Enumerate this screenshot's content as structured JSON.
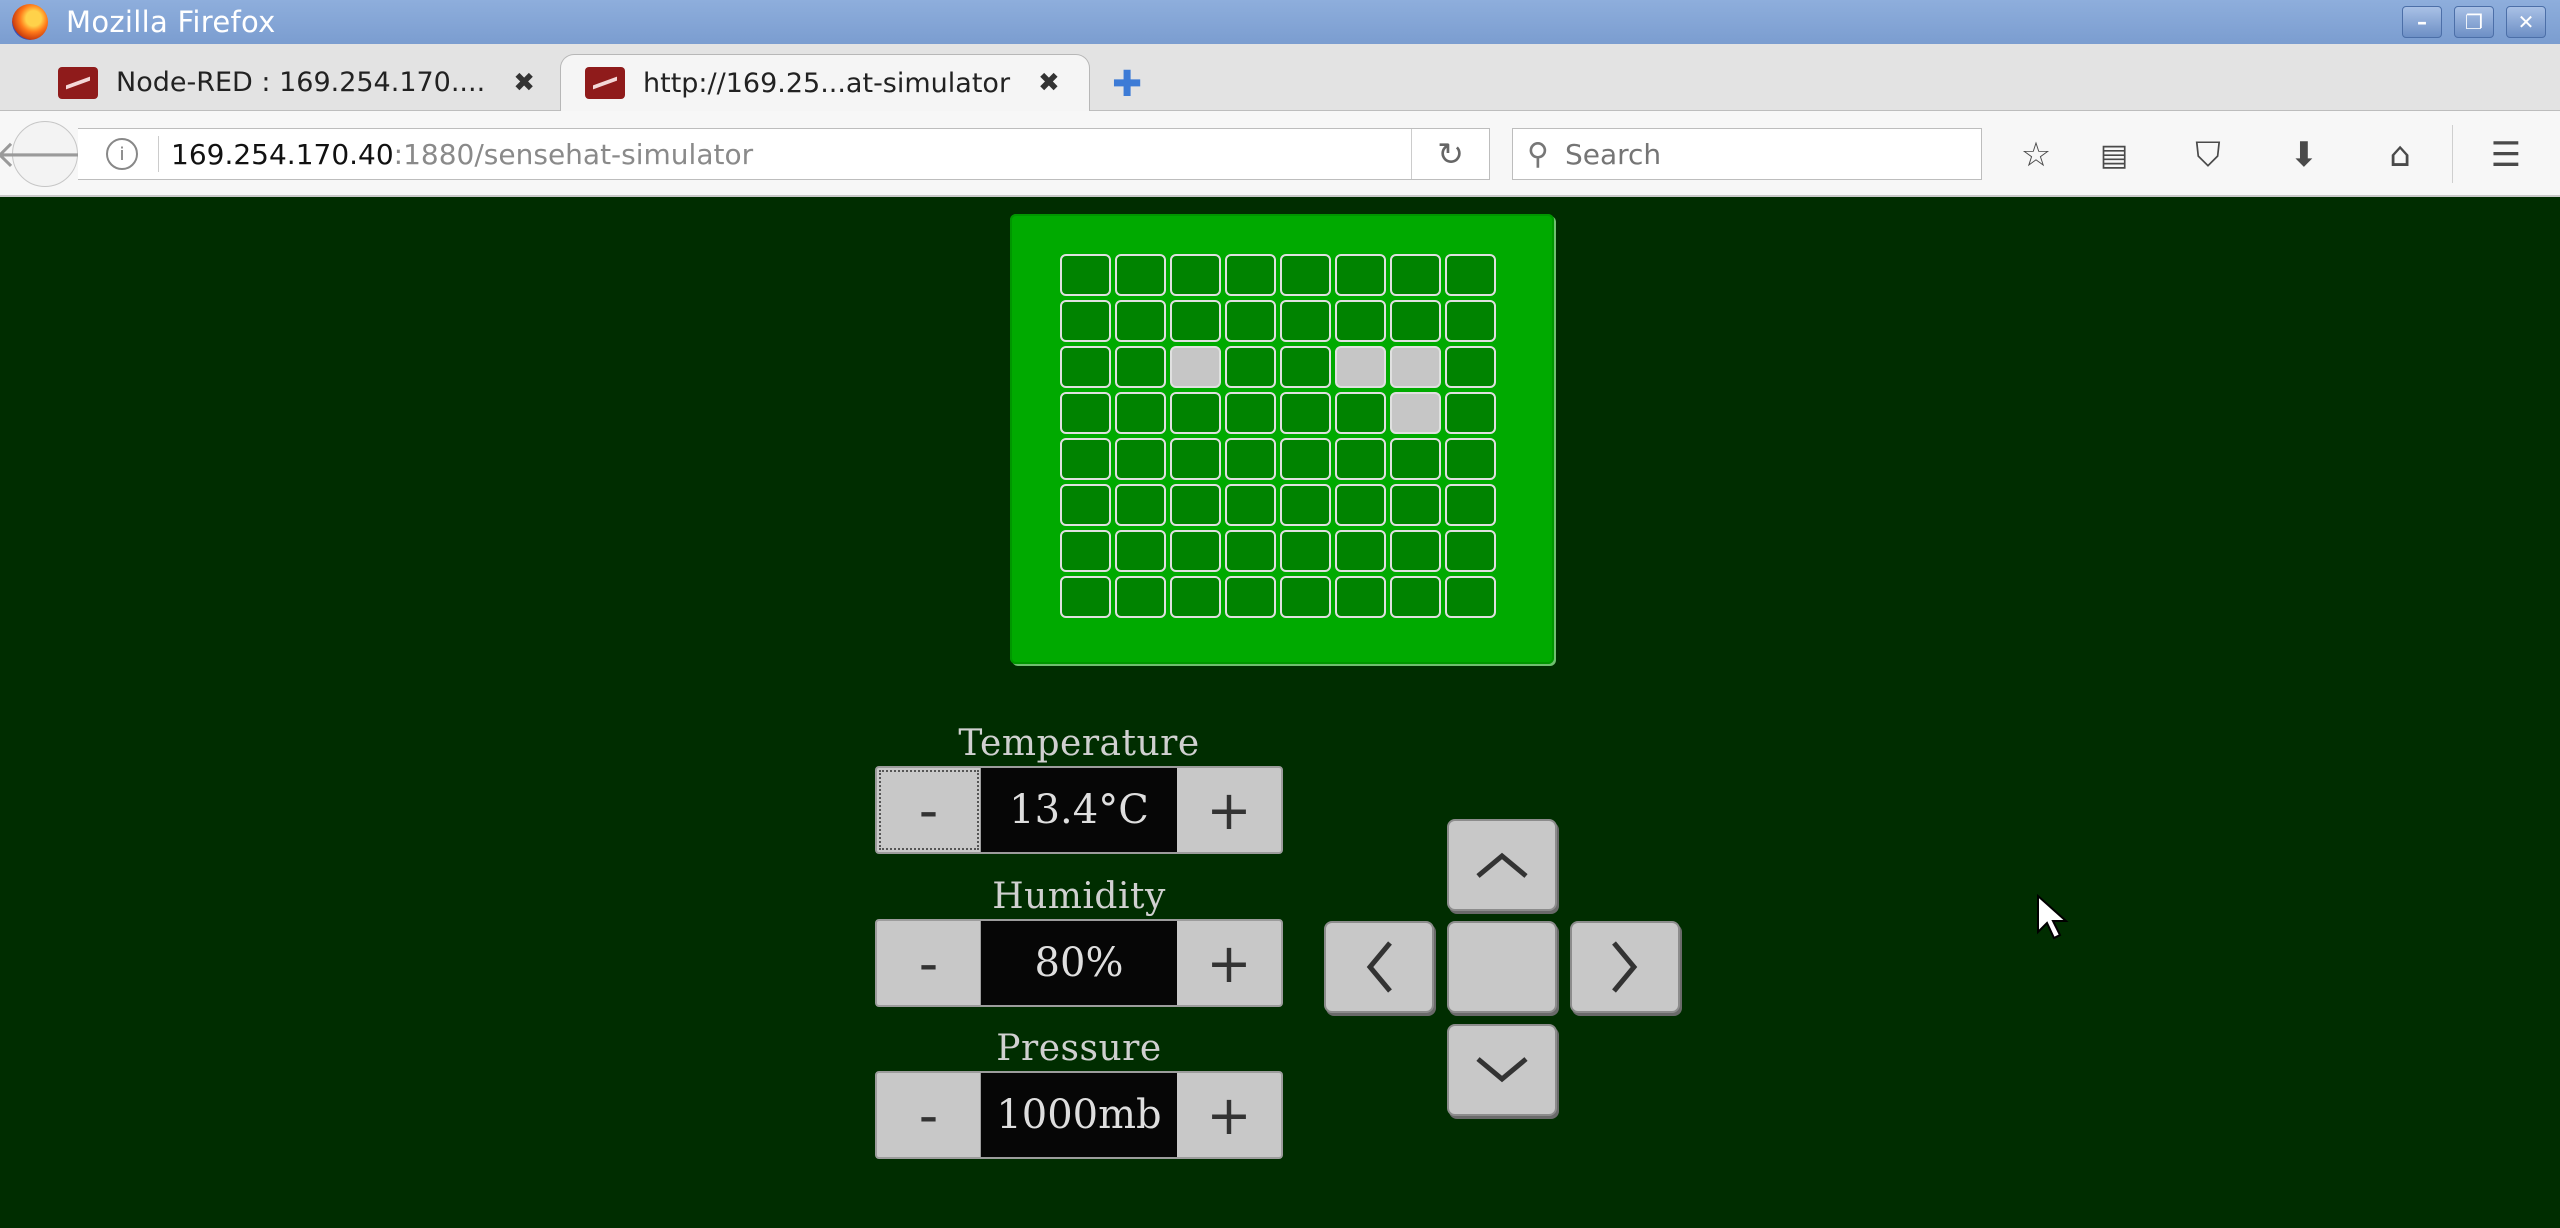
{
  "window": {
    "title": "Mozilla Firefox"
  },
  "tabs": [
    {
      "label": "Node-RED : 169.254.170....",
      "active": false
    },
    {
      "label": "http://169.25...at-simulator",
      "active": true
    }
  ],
  "navbar": {
    "url_host": "169.254.170.40",
    "url_path": ":1880/sensehat-simulator",
    "search_placeholder": "Search"
  },
  "led_matrix": {
    "rows": 8,
    "cols": 8,
    "on_color": "#c6c6c6",
    "off_color": "#008300",
    "lit": [
      [
        2,
        2
      ],
      [
        2,
        5
      ],
      [
        2,
        6
      ],
      [
        3,
        6
      ]
    ]
  },
  "sensors": {
    "temperature": {
      "label": "Temperature",
      "value": "13.4°C"
    },
    "humidity": {
      "label": "Humidity",
      "value": "80%"
    },
    "pressure": {
      "label": "Pressure",
      "value": "1000mb"
    }
  },
  "buttons": {
    "minus": "-",
    "plus": "+"
  },
  "joystick": {
    "up": "up-chevron-icon",
    "down": "down-chevron-icon",
    "left": "left-chevron-icon",
    "right": "right-chevron-icon"
  },
  "colors": {
    "background": "#002d00",
    "board": "#00aa00",
    "led_off": "#008300",
    "led_on": "#c6c6c6"
  }
}
